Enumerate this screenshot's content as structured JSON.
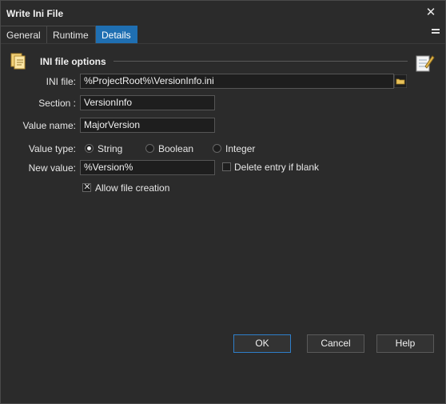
{
  "window": {
    "title": "Write Ini File"
  },
  "tabs": [
    {
      "label": "General"
    },
    {
      "label": "Runtime"
    },
    {
      "label": "Details",
      "active": true
    }
  ],
  "group": {
    "title": "INI file options"
  },
  "fields": {
    "ini_file": {
      "label": "INI file:",
      "value": "%ProjectRoot%\\VersionInfo.ini"
    },
    "section": {
      "label": "Section :",
      "value": "VersionInfo"
    },
    "value_name": {
      "label": "Value name:",
      "value": "MajorVersion"
    },
    "value_type": {
      "label": "Value type:",
      "options": [
        "String",
        "Boolean",
        "Integer"
      ],
      "selected": "String"
    },
    "new_value": {
      "label": "New value:",
      "value": "%Version%"
    }
  },
  "checks": {
    "delete_if_blank": {
      "label": "Delete entry if blank",
      "checked": false
    },
    "allow_creation": {
      "label": "Allow file creation",
      "checked": true
    }
  },
  "buttons": {
    "ok": "OK",
    "cancel": "Cancel",
    "help": "Help"
  },
  "colors": {
    "accent": "#1f6fb2",
    "background": "#2b2b2b",
    "field": "#1e1e1e"
  }
}
